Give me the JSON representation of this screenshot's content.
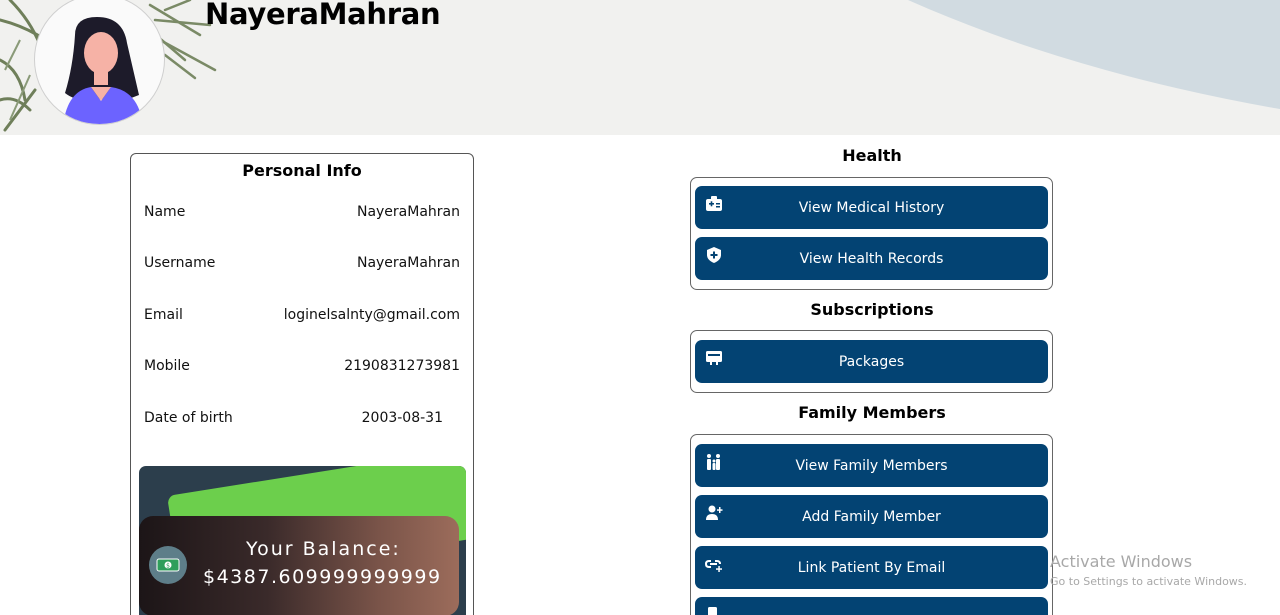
{
  "header": {
    "title": "NayeraMahran"
  },
  "personal_info": {
    "title": "Personal Info",
    "rows": [
      {
        "label": "Name",
        "value": "NayeraMahran"
      },
      {
        "label": "Username",
        "value": "NayeraMahran"
      },
      {
        "label": "Email",
        "value": "loginelsalnty@gmail.com"
      },
      {
        "label": "Mobile",
        "value": "2190831273981"
      },
      {
        "label": "Date of birth",
        "value": "2003-08-31"
      }
    ],
    "balance_label": "Your Balance:",
    "balance_value": "$4387.609999999999"
  },
  "health": {
    "title": "Health",
    "buttons": [
      {
        "label": "View Medical History",
        "icon": "medical-id-icon"
      },
      {
        "label": "View Health Records",
        "icon": "shield-plus-icon"
      }
    ]
  },
  "subscriptions": {
    "title": "Subscriptions",
    "buttons": [
      {
        "label": "Packages",
        "icon": "package-card-icon"
      }
    ]
  },
  "family": {
    "title": "Family Members",
    "buttons": [
      {
        "label": "View Family Members",
        "icon": "family-icon"
      },
      {
        "label": "Add Family Member",
        "icon": "user-plus-icon"
      },
      {
        "label": "Link Patient By Email",
        "icon": "link-plus-icon"
      }
    ]
  },
  "watermark": {
    "line1": "Activate Windows",
    "line2": "Go to Settings to activate Windows."
  },
  "colors": {
    "button": "#034373",
    "banner_bg": "#f1f1ef",
    "banner_shape": "#d1dbe1"
  }
}
